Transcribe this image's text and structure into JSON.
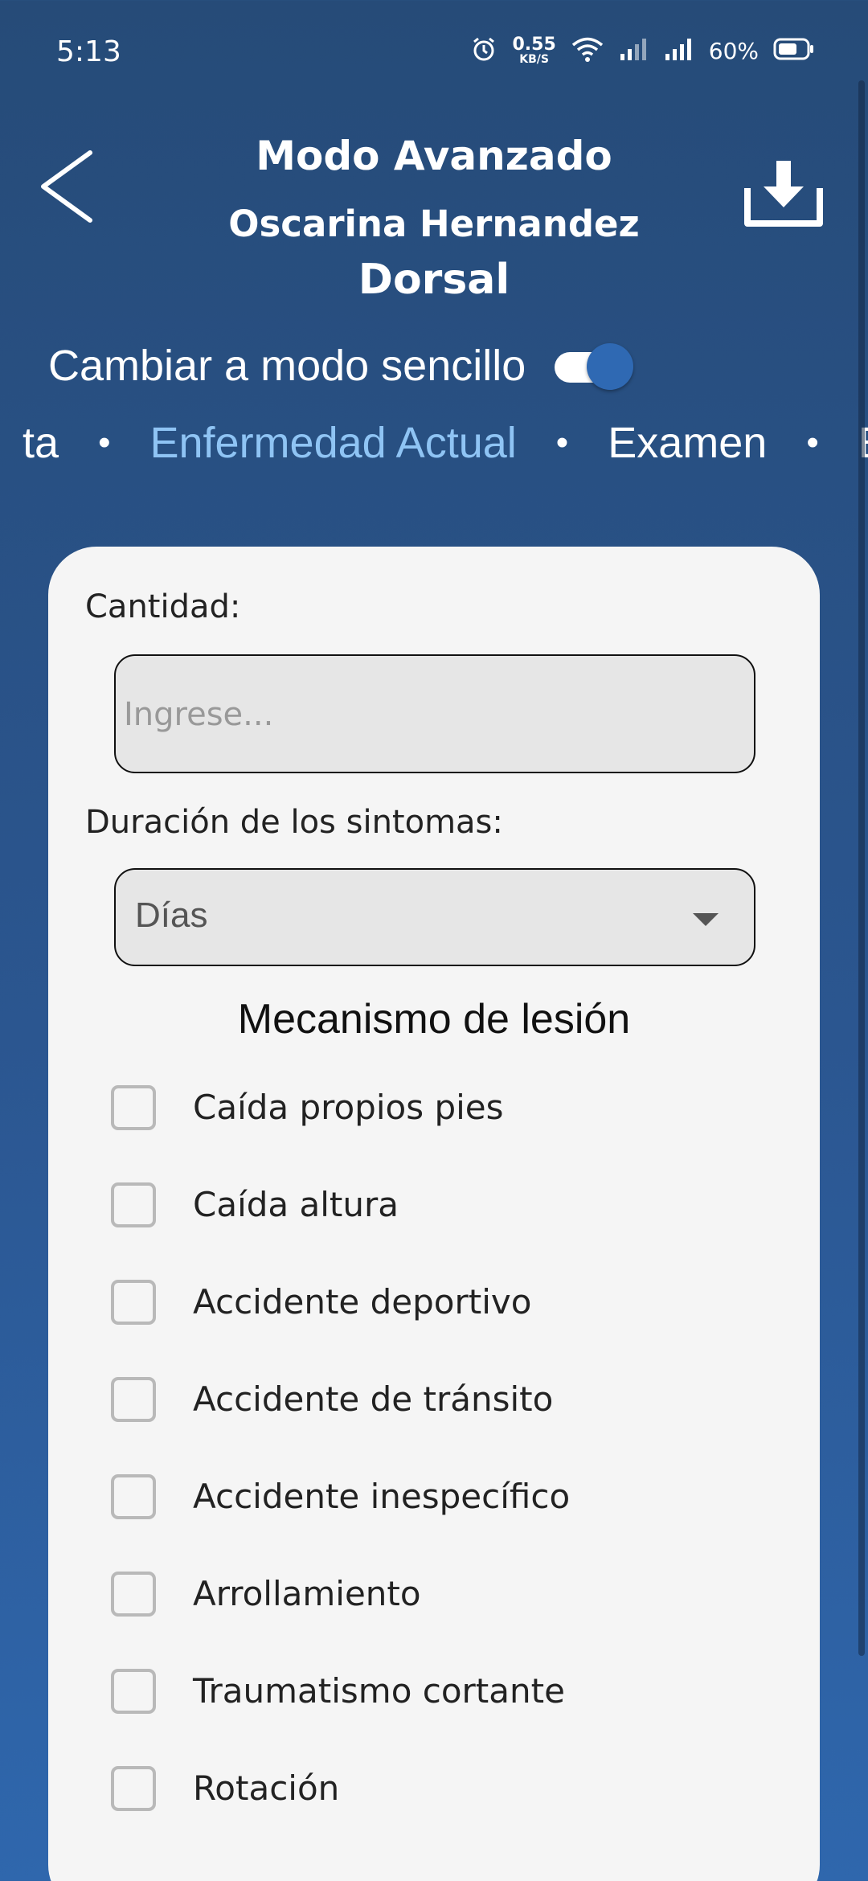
{
  "status_bar": {
    "time": "5:13",
    "net_speed_value": "0.55",
    "net_speed_unit": "KB/S",
    "battery": "60%"
  },
  "header": {
    "title": "Modo Avanzado",
    "patient_name": "Oscarina Hernandez",
    "region": "Dorsal"
  },
  "mode_switch": {
    "label": "Cambiar a modo sencillo",
    "enabled": true
  },
  "tabs": [
    {
      "label": "ta",
      "active": false
    },
    {
      "label": "Enfermedad Actual",
      "active": true
    },
    {
      "label": "Examen",
      "active": false
    },
    {
      "label": "E",
      "active": false
    }
  ],
  "tab_separator": "•",
  "form": {
    "quantity_label": "Cantidad:",
    "quantity_placeholder": "Ingrese...",
    "duration_label": "Duración de los sintomas:",
    "duration_value": "Días",
    "mechanism_title": "Mecanismo de lesión",
    "mechanisms": [
      {
        "label": "Caída propios pies",
        "checked": false
      },
      {
        "label": "Caída altura",
        "checked": false
      },
      {
        "label": "Accidente deportivo",
        "checked": false
      },
      {
        "label": "Accidente de tránsito",
        "checked": false
      },
      {
        "label": "Accidente inespecífico",
        "checked": false
      },
      {
        "label": "Arrollamiento",
        "checked": false
      },
      {
        "label": "Traumatismo cortante",
        "checked": false
      },
      {
        "label": "Rotación",
        "checked": false
      }
    ]
  },
  "colors": {
    "background_top": "#264b78",
    "background_bottom": "#2f67ad",
    "active_tab": "#8fc4f4",
    "toggle_knob": "#2f69b3",
    "card": "#f5f5f5"
  }
}
